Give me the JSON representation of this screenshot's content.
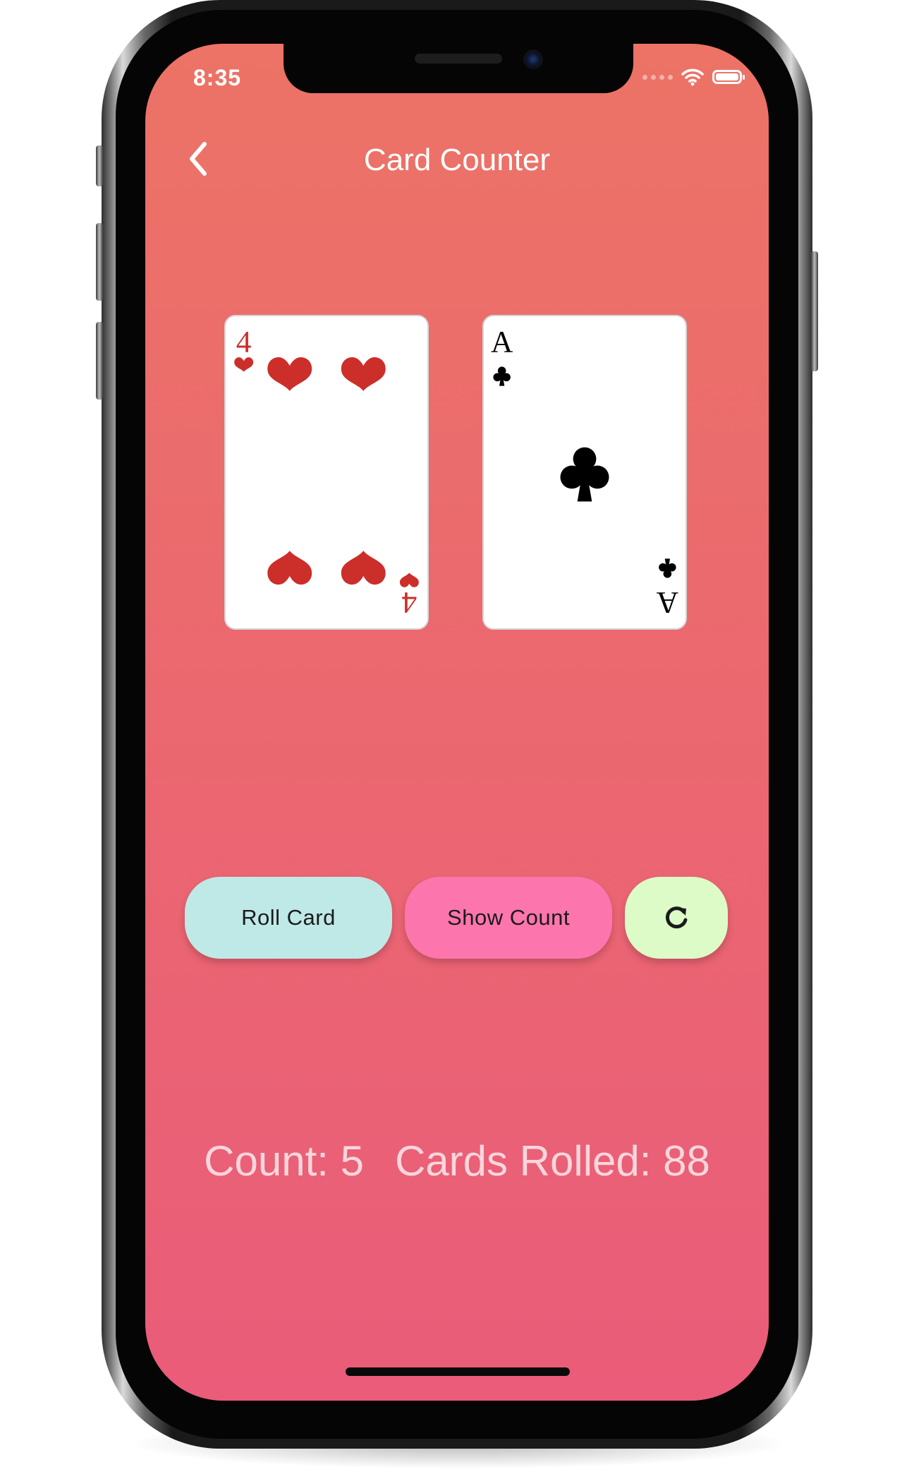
{
  "status_bar": {
    "time": "8:35"
  },
  "header": {
    "title": "Card Counter"
  },
  "cards": [
    {
      "rank": "4",
      "suit": "hearts",
      "color": "#cc2e2a"
    },
    {
      "rank": "A",
      "suit": "clubs",
      "color": "#000000"
    }
  ],
  "buttons": {
    "roll_label": "Roll Card",
    "show_label": "Show Count",
    "refresh_icon": "refresh-icon"
  },
  "stats": {
    "count_label": "Count: 5",
    "rolled_label": "Cards Rolled: 88"
  },
  "colors": {
    "background_top": "#ec7366",
    "background_bottom": "#ea5c79",
    "roll_button": "#bfe9e6",
    "show_button": "#fd75ad",
    "refresh_button": "#ddfbc7",
    "stats_text": "#fbd6dc"
  }
}
